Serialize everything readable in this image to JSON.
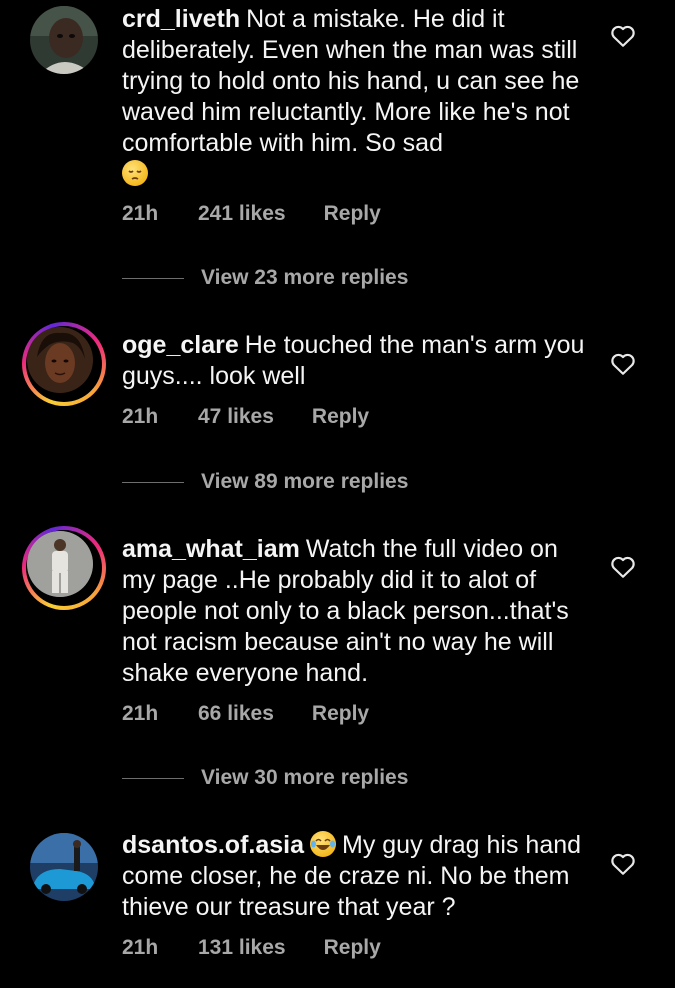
{
  "comments": [
    {
      "username": "crd_liveth",
      "text": "Not a mistake. He did it deliberately. Even when the man was still trying to hold onto his hand, u can see he waved him reluctantly. More like he's not  comfortable with him. So sad",
      "emoji": "pensive-face",
      "time": "21h",
      "likes": "241 likes",
      "reply": "Reply",
      "view_replies": "View 23 more replies"
    },
    {
      "username": "oge_clare",
      "text": "He touched the man's arm you guys.... look well",
      "time": "21h",
      "likes": "47 likes",
      "reply": "Reply",
      "view_replies": "View 89 more replies"
    },
    {
      "username": "ama_what_iam",
      "text": "Watch the full video on my page ..He probably did it to alot of people not only to a black person...that's not racism because ain't no way he will shake everyone hand.",
      "time": "21h",
      "likes": "66 likes",
      "reply": "Reply",
      "view_replies": "View 30 more replies"
    },
    {
      "username": "dsantos.of.asia",
      "emoji": "face-with-tears-of-joy",
      "text": "My guy drag his hand come closer, he de craze ni. No be them thieve our treasure that year ?",
      "time": "21h",
      "likes": "131 likes",
      "reply": "Reply"
    }
  ],
  "colors": {
    "background": "#000000",
    "text": "#f5f5f5",
    "meta": "#a8a8a8",
    "story_ring": [
      "#f9ce34",
      "#ee2a7b",
      "#6228d7"
    ]
  }
}
